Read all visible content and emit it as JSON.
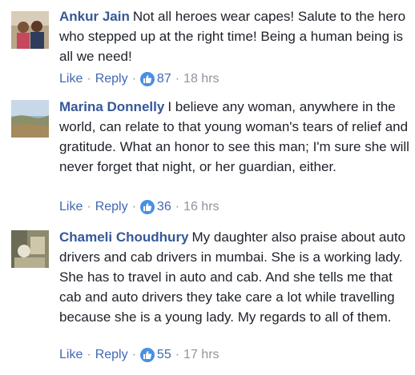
{
  "comments": [
    {
      "name": "Ankur Jain",
      "text": "Not all heroes wear capes! Salute to the hero who stepped up at the right time! Being a human being is all we need!",
      "like_label": "Like",
      "reply_label": "Reply",
      "reaction_count": "87",
      "timestamp": "18 hrs",
      "avatar_icon": "user-avatar-couple"
    },
    {
      "name": "Marina Donnelly",
      "text": "I believe any woman, anywhere in the world, can relate to that young woman's tears of relief and gratitude. What an honor to see this man; I'm sure she will never forget that night, or her guardian, either.",
      "like_label": "Like",
      "reply_label": "Reply",
      "reaction_count": "36",
      "timestamp": "16 hrs",
      "avatar_icon": "user-avatar-landscape"
    },
    {
      "name": "Chameli Choudhury",
      "text": "My daughter also praise about auto drivers and cab drivers in mumbai. She is a working lady. She has to travel in auto and cab. And she tells me that cab and auto drivers they take care a lot while travelling because she is a young lady. My regards to all of them.",
      "like_label": "Like",
      "reply_label": "Reply",
      "reaction_count": "55",
      "timestamp": "17 hrs",
      "avatar_icon": "user-avatar-room"
    }
  ],
  "separator": "·",
  "colors": {
    "name": "#365899",
    "link": "#4267b2",
    "meta": "#90949c",
    "like_badge": "#4a90e2",
    "text": "#1d2129"
  }
}
